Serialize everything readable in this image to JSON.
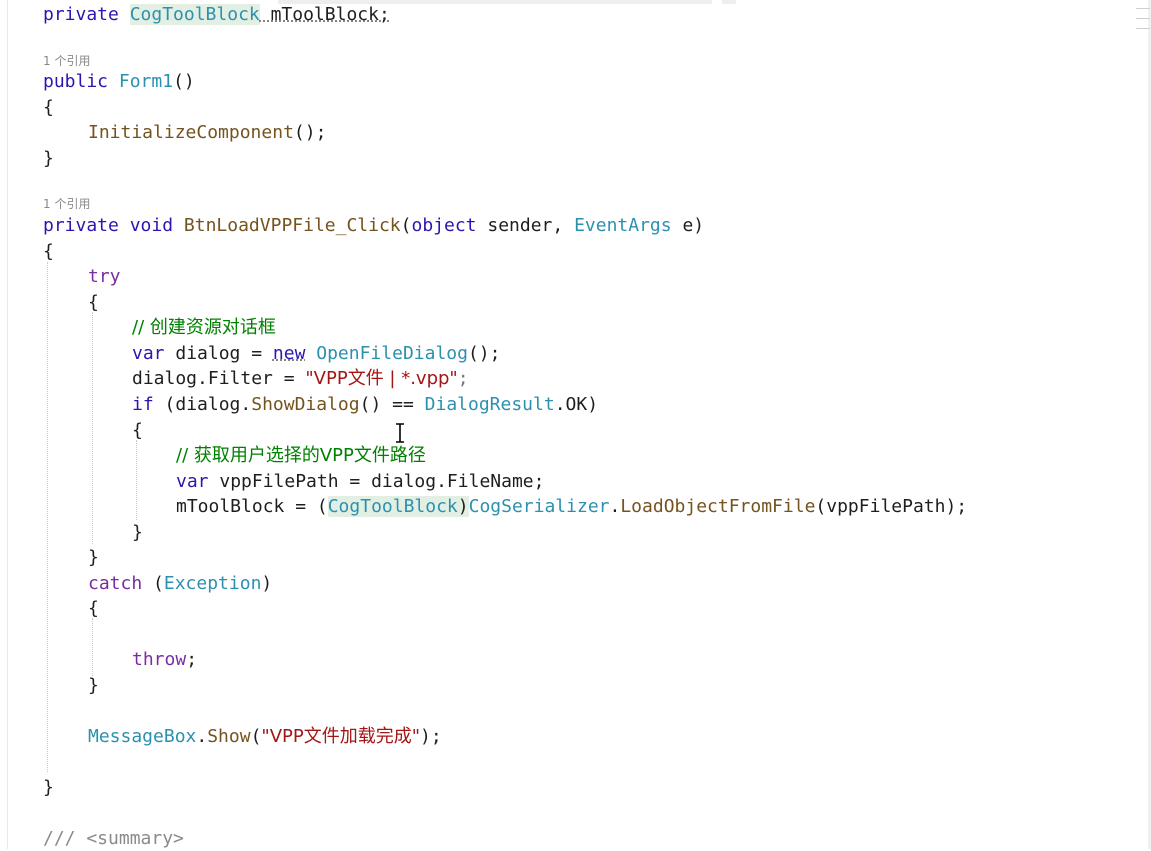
{
  "editor": {
    "field_line": {
      "kw": "private",
      "type": "CogToolBlock",
      "rest": " mToolBlock;"
    },
    "refs_label_1": "1 个引用",
    "ctor": {
      "kw": "public",
      "name": "Form1",
      "parens": "()"
    },
    "open_brace": "{",
    "close_brace": "}",
    "init_call": {
      "name": "InitializeComponent",
      "rest": "();"
    },
    "refs_label_2": "1 个引用",
    "method_sig": {
      "kw1": "private",
      "kw2": "void",
      "name": "BtnLoadVPPFile_Click",
      "p1": "(",
      "kw3": "object",
      "p2": " sender, ",
      "type": "EventArgs",
      "p3": " e)"
    },
    "try_kw": "try",
    "comment_1": "// 创建资源对话框",
    "line_dialog": {
      "kw": "var",
      "mid": " dialog = ",
      "kw2": "new",
      "type": "OpenFileDialog",
      "rest": "();"
    },
    "line_filter": {
      "left": "dialog.Filter = ",
      "str": "\"VPP文件 | *.vpp\"",
      "rest": ";"
    },
    "line_if": {
      "kw": "if",
      "p1": " (dialog.",
      "fn": "ShowDialog",
      "p2": "() == ",
      "type": "DialogResult",
      "rest": ".OK)"
    },
    "comment_2": "// 获取用户选择的VPP文件路径",
    "line_path": {
      "kw": "var",
      "mid": " vppFilePath = dialog.FileName;"
    },
    "line_load": {
      "left": "mToolBlock = (",
      "cast": "CogToolBlock",
      "close": ")",
      "type": "CogSerializer",
      "dot": ".",
      "fn": "LoadObjectFromFile",
      "rest": "(vppFilePath);"
    },
    "catch_line": {
      "kw": "catch",
      "p1": " (",
      "type": "Exception",
      "p2": ")"
    },
    "throw_kw": "throw",
    "throw_rest": ";",
    "msg_line": {
      "type": "MessageBox",
      "dot": ".",
      "fn": "Show",
      "p1": "(",
      "str": "\"VPP文件加载完成\"",
      "rest": ");"
    },
    "xml_doc": "/// <summary>"
  },
  "colors": {
    "keyword": "#2a16b0",
    "control_keyword": "#7a2ca0",
    "type": "#2b91af",
    "method": "#74531f",
    "string": "#a31515",
    "comment": "#008000"
  }
}
